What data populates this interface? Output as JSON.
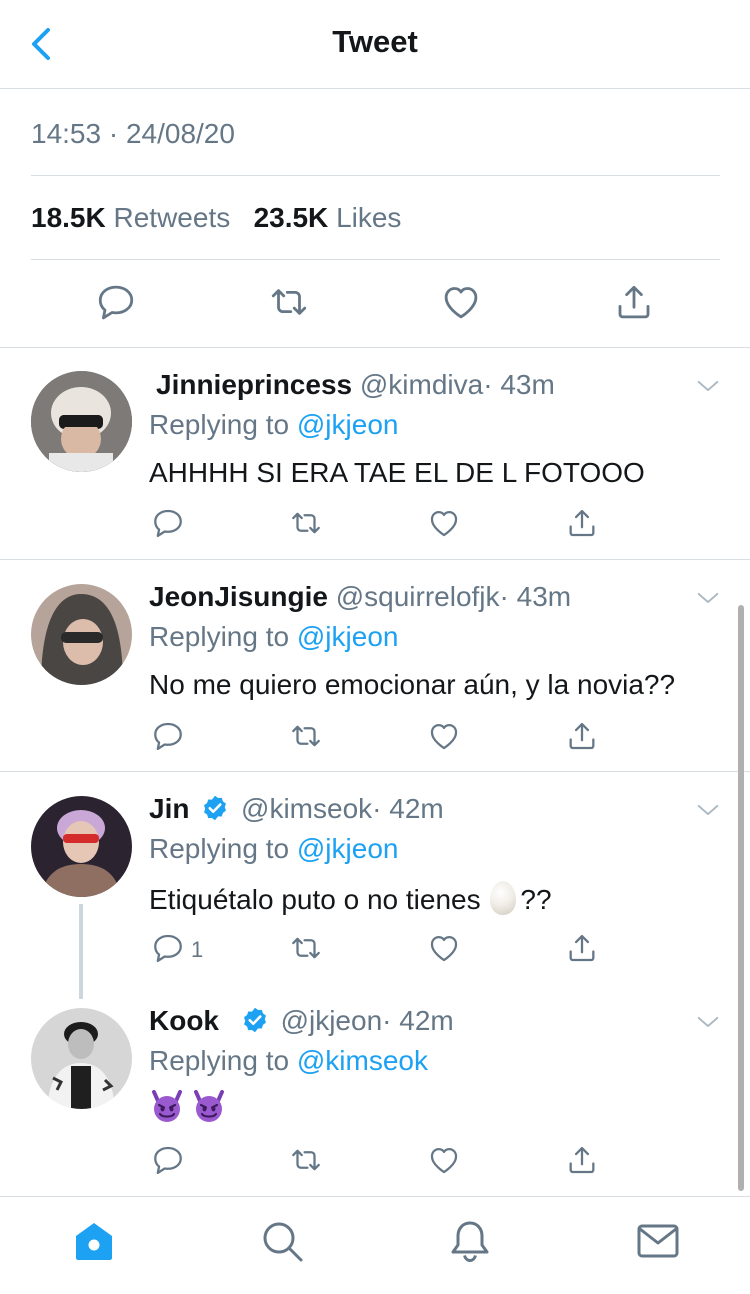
{
  "header": {
    "title": "Tweet"
  },
  "tweet": {
    "timestamp": "14:53 · 24/08/20",
    "retweets_count": "18.5K",
    "retweets_label": "Retweets",
    "likes_count": "23.5K",
    "likes_label": "Likes"
  },
  "replies": [
    {
      "name": "Jinnieprincess",
      "handle": "@kimdiva",
      "time": "· 43m",
      "replying_prefix": "Replying to",
      "replying_to": "@jkjeon",
      "text": "AHHHH SI ERA TAE EL DE L FOTOOO",
      "reply_count": ""
    },
    {
      "name": "JeonJisungie",
      "handle": "@squirrelofjk",
      "time": "· 43m",
      "replying_prefix": "Replying to",
      "replying_to": "@jkjeon",
      "text": "No me quiero emocionar aún, y la novia??",
      "reply_count": ""
    },
    {
      "name": "Jin",
      "handle": "@kimseok",
      "time": "· 42m",
      "replying_prefix": "Replying to",
      "replying_to": "@jkjeon",
      "text_before": "Etiquétalo puto o no tienes",
      "text_after": "??",
      "reply_count": "1"
    },
    {
      "name": "Kook",
      "handle": "@jkjeon",
      "time": "· 42m",
      "replying_prefix": "Replying to",
      "replying_to": "@kimseok",
      "reply_count": ""
    }
  ],
  "colors": {
    "accent": "#1da1f2",
    "text_secondary": "#657786",
    "text_primary": "#14171a",
    "divider": "#d8dde1"
  },
  "icons": {
    "back": "chevron-left-icon",
    "reply": "reply-icon",
    "retweet": "retweet-icon",
    "like": "heart-icon",
    "share": "share-icon",
    "verified": "verified-badge-icon",
    "caret": "chevron-down-icon",
    "tabs": [
      "home-icon",
      "search-icon",
      "notifications-icon",
      "messages-icon"
    ]
  }
}
